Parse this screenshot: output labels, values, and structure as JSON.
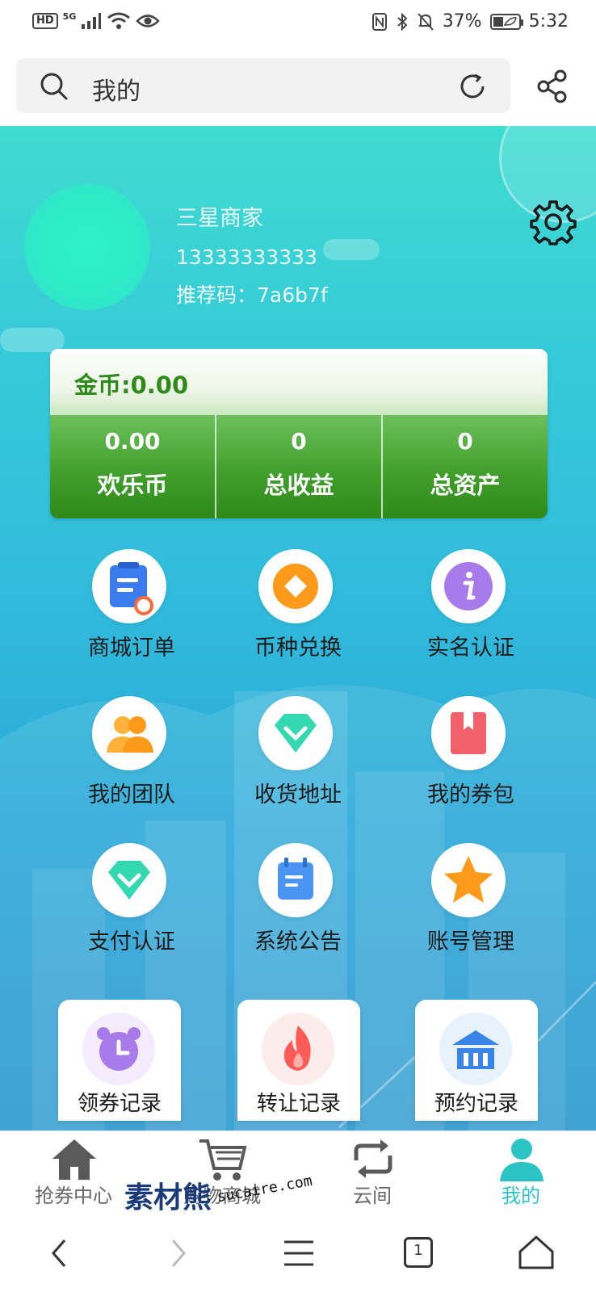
{
  "status": {
    "hd": "HD",
    "network": "5G",
    "battery_pct": "37%",
    "time": "5:32"
  },
  "searchbar": {
    "title": "我的",
    "icons": [
      "search-icon",
      "refresh-icon",
      "share-icon"
    ]
  },
  "profile": {
    "name": "三星商家",
    "phone": "13333333333",
    "referral": "推荐码：7a6b7f",
    "settings_icon": "gear-icon"
  },
  "coins": {
    "gold_label": "金币:0.00",
    "stats": [
      {
        "value": "0.00",
        "label": "欢乐币"
      },
      {
        "value": "0",
        "label": "总收益"
      },
      {
        "value": "0",
        "label": "总资产"
      }
    ]
  },
  "menu": [
    {
      "label": "商城订单",
      "icon": "order-icon",
      "color": "#3a7bf0"
    },
    {
      "label": "币种兑换",
      "icon": "coin-exchange-icon",
      "color": "#ff9a1a"
    },
    {
      "label": "实名认证",
      "icon": "info-icon",
      "color": "#a87bea"
    },
    {
      "label": "我的团队",
      "icon": "team-icon",
      "color": "#ffa12a"
    },
    {
      "label": "收货地址",
      "icon": "diamond-icon",
      "color": "#33d7b0"
    },
    {
      "label": "我的券包",
      "icon": "bookmark-icon",
      "color": "#f2606a"
    },
    {
      "label": "支付认证",
      "icon": "diamond-icon",
      "color": "#33d7b0"
    },
    {
      "label": "系统公告",
      "icon": "notice-icon",
      "color": "#4a95f0"
    },
    {
      "label": "账号管理",
      "icon": "star-icon",
      "color": "#ff9a1a"
    }
  ],
  "records": [
    {
      "label": "领券记录",
      "icon": "alarm-clock-icon",
      "color": "#a87bea"
    },
    {
      "label": "转让记录",
      "icon": "fire-icon",
      "color": "#ff5a5a"
    },
    {
      "label": "预约记录",
      "icon": "bank-icon",
      "color": "#3a86e8"
    }
  ],
  "bottom_nav": [
    {
      "label": "抢券中心",
      "icon": "home-icon"
    },
    {
      "label": "购物商城",
      "icon": "cart-icon"
    },
    {
      "label": "云间",
      "icon": "loop-icon"
    },
    {
      "label": "我的",
      "icon": "user-icon"
    }
  ],
  "watermark": {
    "text1": "素材熊",
    "text2": "sucaire.com"
  },
  "system_nav": {
    "tab_count": "1"
  }
}
